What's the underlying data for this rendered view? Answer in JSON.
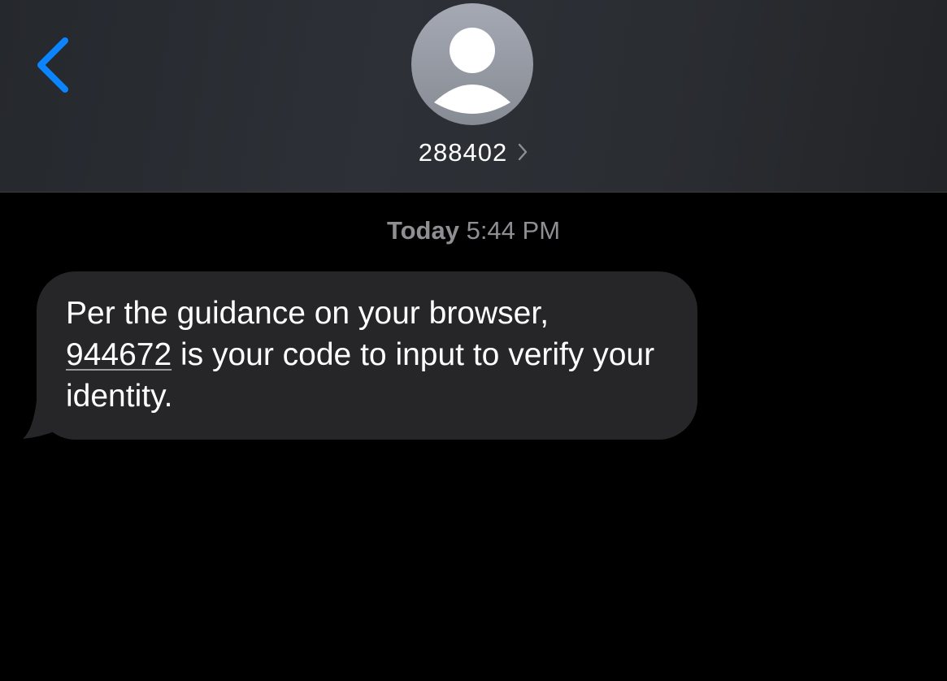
{
  "header": {
    "contact_name": "288402",
    "avatar_icon": "person-silhouette-icon",
    "back_icon": "chevron-left-icon",
    "detail_icon": "chevron-right-icon"
  },
  "conversation": {
    "timestamp_day": "Today",
    "timestamp_time": "5:44 PM",
    "messages": [
      {
        "direction": "incoming",
        "text_before": "Per the guidance on your browser,",
        "code": "944672",
        "text_after": " is your code to input to verify your identity."
      }
    ]
  },
  "colors": {
    "accent": "#0a84ff",
    "background": "#000000",
    "bubble": "#262628",
    "secondary_text": "#8e8e93"
  }
}
